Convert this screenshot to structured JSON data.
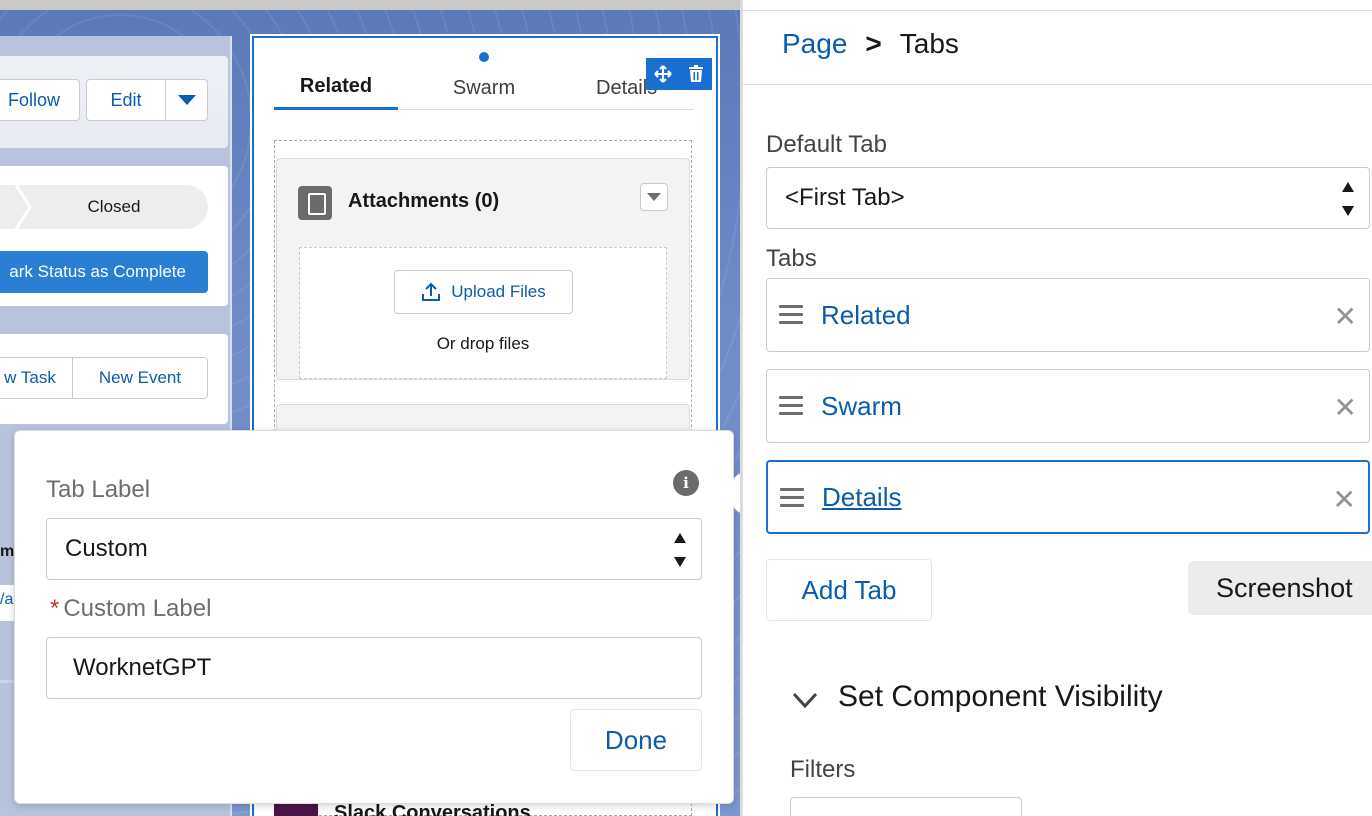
{
  "record": {
    "follow_label": "Follow",
    "edit_label": "Edit",
    "path_stage": "Closed",
    "mark_complete_label": "ark Status as Complete",
    "new_task_label": "w Task",
    "new_event_label": "New Event",
    "fragment_1": "m",
    "fragment_2": "/a"
  },
  "tabs_component": {
    "tabs": [
      {
        "label": "Related",
        "active": true
      },
      {
        "label": "Swarm",
        "active": false
      },
      {
        "label": "Details",
        "active": false
      }
    ],
    "toolbar": {
      "move_icon": "move-icon",
      "delete_icon": "trash-icon"
    },
    "attachments": {
      "title": "Attachments (0)",
      "upload_label": "Upload Files",
      "drop_text": "Or drop files"
    },
    "slack_title": "Slack Conversations"
  },
  "popover": {
    "tab_label_title": "Tab Label",
    "tab_label_value": "Custom",
    "custom_label_title": "Custom Label",
    "required_mark": "*",
    "custom_label_value": "WorknetGPT",
    "done_label": "Done"
  },
  "panel": {
    "breadcrumb": {
      "parent": "Page",
      "separator": ">",
      "current": "Tabs"
    },
    "default_tab_label": "Default Tab",
    "default_tab_value": "<First Tab>",
    "tabs_label": "Tabs",
    "tab_items": [
      {
        "label": "Related",
        "selected": false
      },
      {
        "label": "Swarm",
        "selected": false
      },
      {
        "label": "Details",
        "selected": true
      }
    ],
    "add_tab_label": "Add Tab",
    "screenshot_tooltip": "Screenshot",
    "visibility_section": "Set Component Visibility",
    "filters_label": "Filters"
  },
  "colors": {
    "accent": "#1b6fd0",
    "link": "#0b5cab",
    "brand_button": "#2a7fd4"
  }
}
